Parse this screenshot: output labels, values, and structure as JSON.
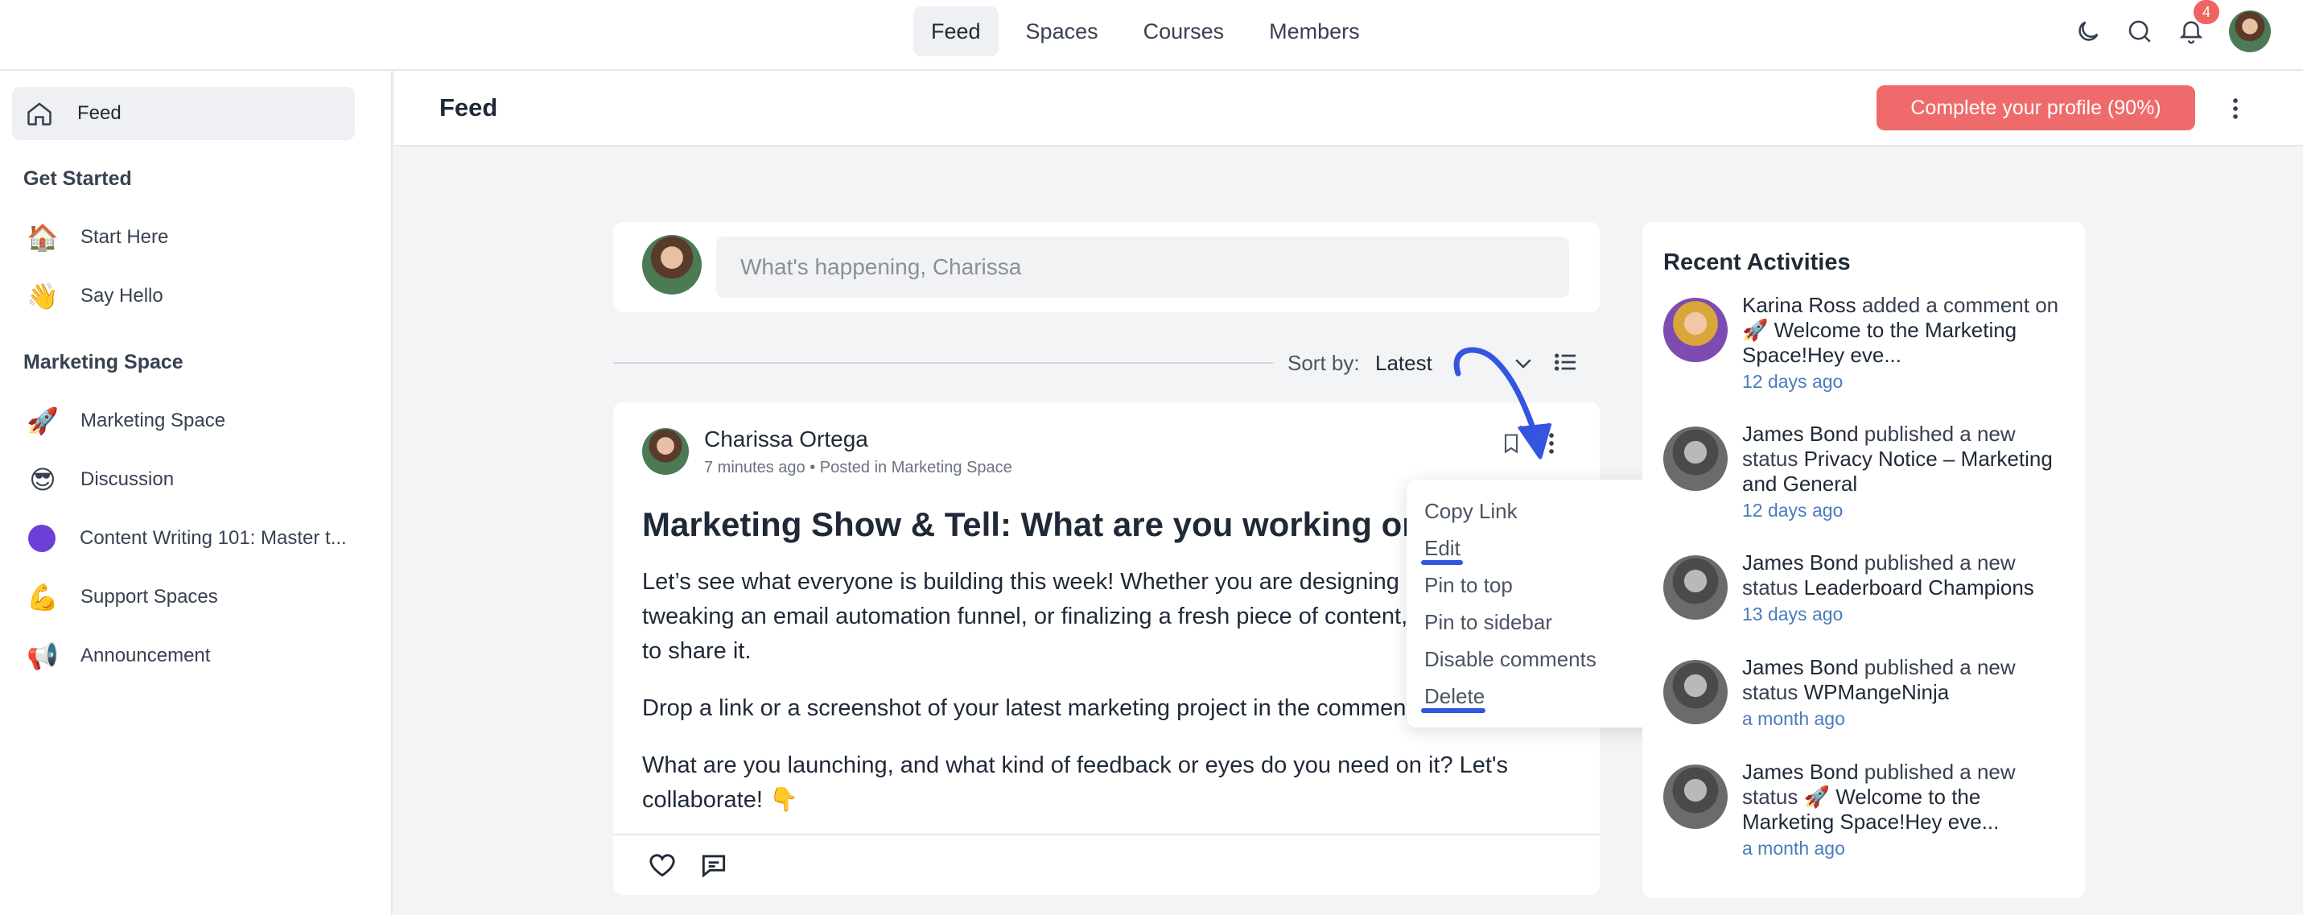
{
  "topnav": {
    "tabs": [
      {
        "label": "Feed",
        "active": true
      },
      {
        "label": "Spaces"
      },
      {
        "label": "Courses"
      },
      {
        "label": "Members"
      }
    ],
    "icons": [
      "moon-icon",
      "search-icon",
      "bell-icon"
    ],
    "notification_count": "4"
  },
  "sidebar": {
    "feed_label": "Feed",
    "section1": {
      "heading": "Get Started",
      "items": [
        {
          "emoji": "🏠",
          "label": "Start Here"
        },
        {
          "emoji": "👋",
          "label": "Say Hello"
        }
      ]
    },
    "section2": {
      "heading": "Marketing Space",
      "items": [
        {
          "emoji": "🚀",
          "label": "Marketing Space"
        },
        {
          "emoji": "😎",
          "label": "Discussion"
        },
        {
          "emoji": "",
          "label": "Content Writing 101: Master t..."
        },
        {
          "emoji": "💪",
          "label": "Support Spaces"
        },
        {
          "emoji": "📢",
          "label": "Announcement"
        }
      ]
    }
  },
  "header": {
    "title": "Feed",
    "complete_profile": "Complete your profile (90%)"
  },
  "composer": {
    "placeholder": "What's happening, Charissa"
  },
  "sort": {
    "label": "Sort by:",
    "value": "Latest"
  },
  "post": {
    "author": "Charissa Ortega",
    "meta": "7 minutes ago • Posted in Marketing Space",
    "title": "Marketing Show & Tell: What are you working on?",
    "paragraphs": [
      "Let’s see what everyone is building this week! Whether you are designing a page, tweaking an email automation funnel, or finalizing a fresh piece of content, use your space to share it.",
      "Drop a link or a screenshot of your latest marketing project in the comments.",
      "What are you launching, and what kind of feedback or eyes do you need on it? Let's collaborate! 👇"
    ]
  },
  "post_menu": {
    "items": [
      "Copy Link",
      "Edit",
      "Pin to top",
      "Pin to sidebar",
      "Disable comments",
      "Delete"
    ]
  },
  "recent": {
    "title": "Recent Activities",
    "items": [
      {
        "name": "Karina Ross",
        "action": " added a comment on ",
        "target": "🚀 Welcome to the Marketing Space!Hey eve...",
        "time": "12 days ago"
      },
      {
        "name": "James Bond",
        "action": " published a new status ",
        "target": "Privacy Notice – Marketing and General",
        "time": "12 days ago"
      },
      {
        "name": "James Bond",
        "action": " published a new status ",
        "target": "Leaderboard Champions",
        "time": "13 days ago"
      },
      {
        "name": "James Bond",
        "action": " published a new status ",
        "target": "WPMangeNinja",
        "time": "a month ago"
      },
      {
        "name": "James Bond",
        "action": " published a new status ",
        "target": "🚀 Welcome to the Marketing Space!Hey eve...",
        "time": "a month ago"
      }
    ]
  },
  "colors": {
    "accent_button": "#ef6b6b",
    "badge": "#ef6461",
    "annotation_blue": "#3355e0",
    "time_link": "#4a7bbd"
  }
}
